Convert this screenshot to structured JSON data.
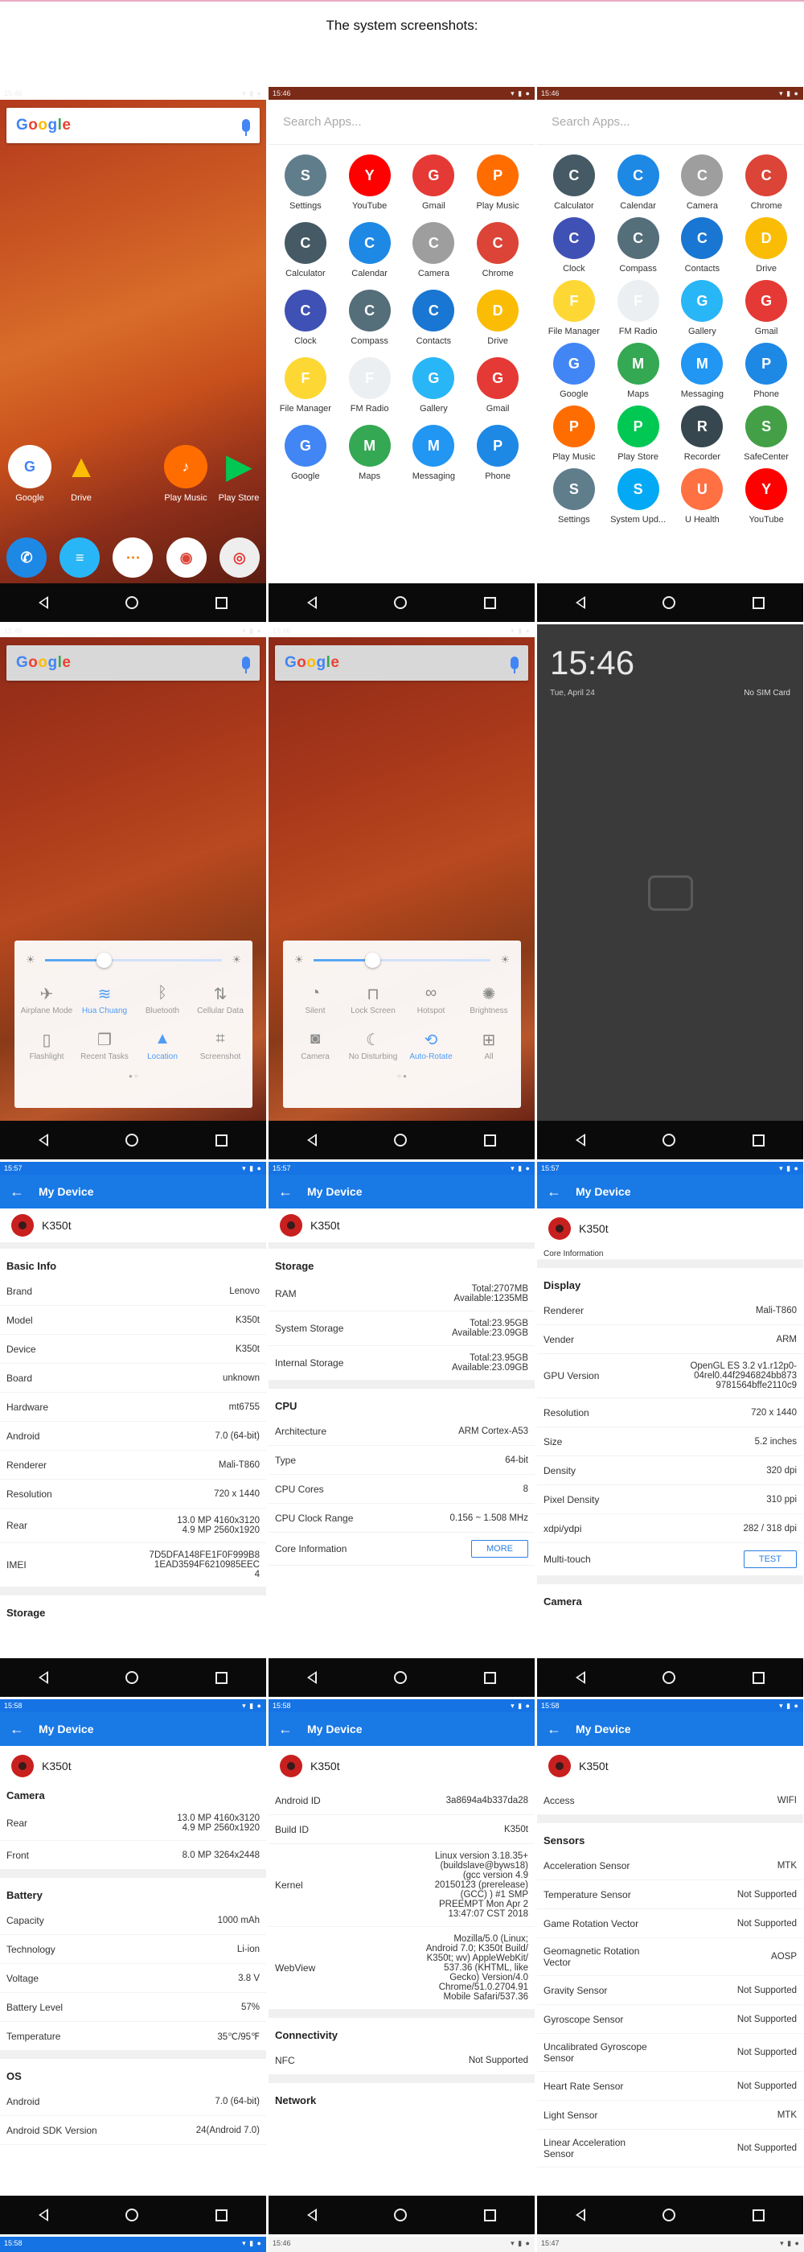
{
  "header": {
    "title": "The system screenshots:"
  },
  "time_a": "15:46",
  "time_b": "15:57",
  "time_c": "15:58",
  "home": {
    "apps": [
      "Google",
      "Drive",
      "Play Music",
      "Play Store"
    ]
  },
  "drawer": {
    "search_placeholder": "Search Apps...",
    "apps1": [
      "Settings",
      "YouTube",
      "Gmail",
      "Play Music",
      "Calculator",
      "Calendar",
      "Camera",
      "Chrome",
      "Clock",
      "Compass",
      "Contacts",
      "Drive",
      "File Manager",
      "FM Radio",
      "Gallery",
      "Gmail",
      "Google",
      "Maps",
      "Messaging",
      "Phone"
    ],
    "apps2": [
      "Calculator",
      "Calendar",
      "Camera",
      "Chrome",
      "Clock",
      "Compass",
      "Contacts",
      "Drive",
      "File Manager",
      "FM Radio",
      "Gallery",
      "Gmail",
      "Google",
      "Maps",
      "Messaging",
      "Phone",
      "Play Music",
      "Play Store",
      "Recorder",
      "SafeCenter",
      "Settings",
      "System Upd...",
      "U Health",
      "YouTube"
    ]
  },
  "qs1": [
    "Airplane Mode",
    "Hua Chuang",
    "Bluetooth",
    "Cellular Data",
    "Flashlight",
    "Recent Tasks",
    "Location",
    "Screenshot"
  ],
  "qs2": [
    "Silent",
    "Lock Screen",
    "Hotspot",
    "Brightness",
    "Camera",
    "No Disturbing",
    "Auto-Rotate",
    "All"
  ],
  "lock": {
    "time": "15:46",
    "date": "Tue, April 24",
    "sim": "No SIM Card"
  },
  "device": {
    "toolbar_title": "My Device",
    "model_name": "K350t",
    "s4": {
      "section": "Basic Info",
      "rows": [
        [
          "Brand",
          "Lenovo"
        ],
        [
          "Model",
          "K350t"
        ],
        [
          "Device",
          "K350t"
        ],
        [
          "Board",
          "unknown"
        ],
        [
          "Hardware",
          "mt6755"
        ],
        [
          "Android",
          "7.0 (64-bit)"
        ],
        [
          "Renderer",
          "Mali-T860"
        ],
        [
          "Resolution",
          "720 x 1440"
        ],
        [
          "Rear",
          "13.0 MP 4160x3120\n4.9 MP 2560x1920"
        ],
        [
          "IMEI",
          "7D5DFA148FE1F0F999B8\n1EAD3594F6210985EEC\n4"
        ]
      ],
      "next": "Storage"
    },
    "s5": {
      "storage": "Storage",
      "storage_rows": [
        [
          "RAM",
          "Total:2707MB\nAvailable:1235MB"
        ],
        [
          "System Storage",
          "Total:23.95GB\nAvailable:23.09GB"
        ],
        [
          "Internal Storage",
          "Total:23.95GB\nAvailable:23.09GB"
        ]
      ],
      "cpu": "CPU",
      "cpu_rows": [
        [
          "Architecture",
          "ARM Cortex-A53"
        ],
        [
          "Type",
          "64-bit"
        ],
        [
          "CPU Cores",
          "8"
        ],
        [
          "CPU Clock Range",
          "0.156 ~ 1.508 MHz"
        ]
      ],
      "core_info": "Core Information",
      "more": "MORE"
    },
    "s6": {
      "core_info": "Core Information",
      "display": "Display",
      "rows": [
        [
          "Renderer",
          "Mali-T860"
        ],
        [
          "Vender",
          "ARM"
        ],
        [
          "GPU Version",
          "OpenGL ES 3.2 v1.r12p0-04rel0.44f2946824bb873\n9781564bffe2110c9"
        ],
        [
          "Resolution",
          "720 x 1440"
        ],
        [
          "Size",
          "5.2 inches"
        ],
        [
          "Density",
          "320 dpi"
        ],
        [
          "Pixel Density",
          "310 ppi"
        ],
        [
          "xdpi/ydpi",
          "282 / 318 dpi"
        ]
      ],
      "multitouch": "Multi-touch",
      "test": "TEST",
      "camera": "Camera"
    },
    "s7": {
      "camera": "Camera",
      "camera_rows": [
        [
          "Rear",
          "13.0 MP 4160x3120\n4.9 MP 2560x1920"
        ],
        [
          "Front",
          "8.0 MP 3264x2448"
        ]
      ],
      "battery": "Battery",
      "battery_rows": [
        [
          "Capacity",
          "1000 mAh"
        ],
        [
          "Technology",
          "Li-ion"
        ],
        [
          "Voltage",
          "3.8 V"
        ],
        [
          "Battery Level",
          "57%"
        ],
        [
          "Temperature",
          "35℃/95℉"
        ]
      ],
      "os": "OS",
      "os_rows": [
        [
          "Android",
          "7.0 (64-bit)"
        ],
        [
          "Android SDK Version",
          "24(Android 7.0)"
        ]
      ]
    },
    "s8": {
      "rows": [
        [
          "Android ID",
          "3a8694a4b337da28"
        ],
        [
          "Build ID",
          "K350t"
        ],
        [
          "Kernel",
          "Linux version 3.18.35+\n(buildslave@byws18)\n(gcc version 4.9\n20150123 (prerelease)\n(GCC) ) #1 SMP\nPREEMPT Mon Apr 2\n13:47:07 CST 2018"
        ],
        [
          "WebView",
          "Mozilla/5.0 (Linux;\nAndroid 7.0; K350t Build/\nK350t; wv) AppleWebKit/\n537.36 (KHTML, like\nGecko) Version/4.0\nChrome/51.0.2704.91\nMobile Safari/537.36"
        ]
      ],
      "connectivity": "Connectivity",
      "nfc": [
        "NFC",
        "Not Supported"
      ],
      "network": "Network"
    },
    "s9": {
      "access": [
        "Access",
        "WIFI"
      ],
      "sensors": "Sensors",
      "rows": [
        [
          "Acceleration Sensor",
          "MTK"
        ],
        [
          "Temperature Sensor",
          "Not Supported"
        ],
        [
          "Game Rotation Vector",
          "Not Supported"
        ],
        [
          "Geomagnetic Rotation Vector",
          "AOSP"
        ],
        [
          "Gravity Sensor",
          "Not Supported"
        ],
        [
          "Gyroscope Sensor",
          "Not Supported"
        ],
        [
          "Uncalibrated Gyroscope Sensor",
          "Not Supported"
        ],
        [
          "Heart Rate Sensor",
          "Not Supported"
        ],
        [
          "Light Sensor",
          "MTK"
        ],
        [
          "Linear Acceleration Sensor",
          "Not Supported"
        ]
      ]
    }
  },
  "bottom_times": [
    "15:58",
    "15:46",
    "15:47"
  ],
  "colors": {
    "accent": "#1979e5",
    "wallpaper": "#c85422"
  }
}
